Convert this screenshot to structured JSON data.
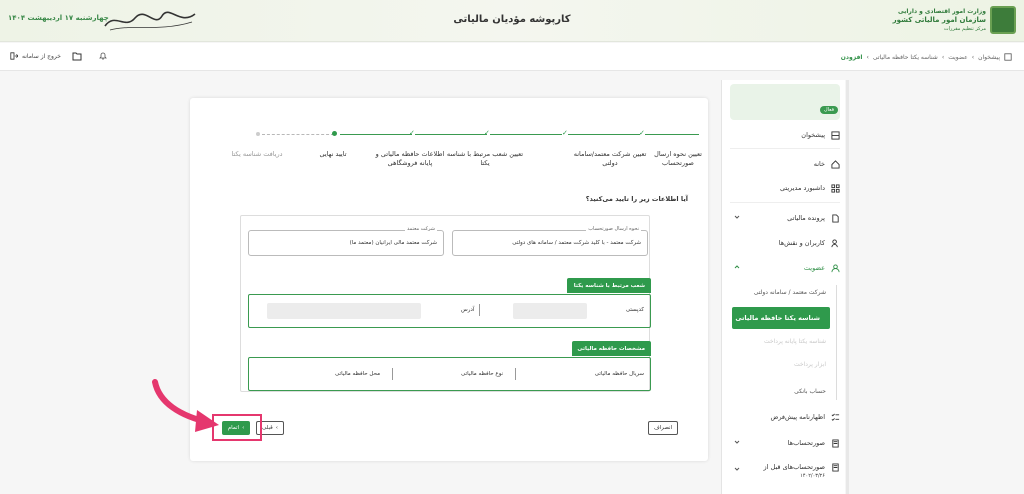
{
  "header": {
    "title": "کارپوشه مؤدیان مالیاتی",
    "date": "چهارشنبه ۱۷ اردیبهشت ۱۴۰۴",
    "logo_line1": "وزارت امور اقتصادی و دارایی",
    "logo_line2": "سازمان امور مالیاتی کشور",
    "logo_line3": "مرکز تنظیم مقررات"
  },
  "toolbar": {
    "logout_label": "خروج از سامانه",
    "breadcrumb": [
      "پیشخوان",
      "عضویت",
      "شناسه یکتا حافظه مالیاتی",
      "افزودن"
    ]
  },
  "sidebar": {
    "status_badge": "فعال",
    "items": [
      {
        "label": "پیشخوان"
      },
      {
        "label": "خانه"
      },
      {
        "label": "داشبورد مدیریتی"
      },
      {
        "label": "پرونده مالیاتی"
      },
      {
        "label": "کاربران و نقش‌ها"
      },
      {
        "label": "عضویت"
      },
      {
        "label": "اظهارنامه پیش‌فرض"
      },
      {
        "label": "صورتحساب‌ها"
      },
      {
        "label": "صورتحساب‌های قبل از"
      },
      {
        "label": "۱۴۰۲/۰۳/۲۶"
      }
    ],
    "sub_items": [
      {
        "label": "شرکت معتمد / سامانه دولتی"
      },
      {
        "label": "شناسه یکتا حافظه مالیاتی"
      },
      {
        "label": "شناسه یکتا پایانه پرداخت"
      },
      {
        "label": "ابزار پرداخت"
      },
      {
        "label": "حساب بانکی"
      }
    ]
  },
  "steps": [
    {
      "label": "تعیین نحوه ارسال صورتحساب"
    },
    {
      "label": "تعیین شرکت معتمد/سامانه دولتی"
    },
    {
      "label": "تعیین شعب مرتبط با شناسه یکتا"
    },
    {
      "label": "اطلاعات حافظه مالیاتی و پایانه فروشگاهی"
    },
    {
      "label": "تایید نهایی"
    },
    {
      "label": "دریافت شناسه یکتا"
    }
  ],
  "form": {
    "question": "آیا اطلاعات زیر را تایید می‌کنید؟",
    "send_method_label": "نحوه ارسال صورتحساب",
    "send_method_value": "شرکت معتمد - با کلید شرکت معتمد / سامانه های دولتی",
    "trusted_company_label": "شرکت معتمد",
    "trusted_company_value": "شرکت معتمد مالی ایرانیان (معتمد ما)",
    "branches_header": "شعب مرتبط با شناسه یکتا",
    "branch_code_label": "کدپستی",
    "branch_address_label": "آدرس",
    "memory_header": "مشخصات حافظه مالیاتی",
    "serial_label": "سریال حافظه مالیاتی",
    "type_label": "نوع حافظه مالیاتی",
    "location_label": "محل حافظه مالیاتی"
  },
  "buttons": {
    "cancel": "انصراف",
    "prev": "قبلی",
    "finish": "اتمام"
  },
  "colors": {
    "accent": "#2f9a4c",
    "highlight": "#e5376e"
  }
}
